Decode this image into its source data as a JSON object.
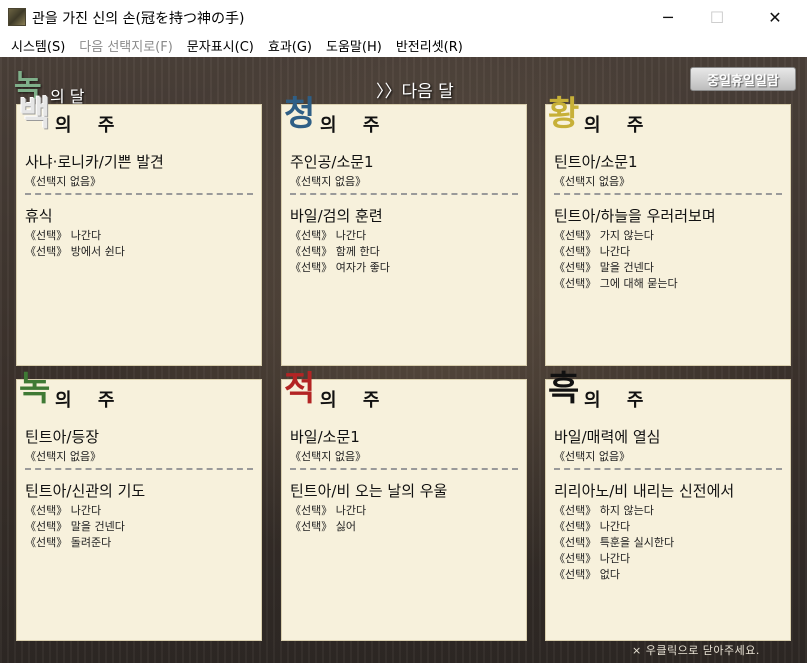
{
  "window": {
    "title": "관을 가진 신의 손(冠を持つ神の手)",
    "minimize": "─",
    "maximize": "☐",
    "close": "✕"
  },
  "menu": [
    {
      "label": "시스템(S)",
      "enabled": true
    },
    {
      "label": "다음 선택지로(F)",
      "enabled": false
    },
    {
      "label": "문자표시(C)",
      "enabled": true
    },
    {
      "label": "효과(G)",
      "enabled": true
    },
    {
      "label": "도움말(H)",
      "enabled": true
    },
    {
      "label": "반전리셋(R)",
      "enabled": true
    }
  ],
  "header": {
    "month_char": "녹",
    "month_rest": "의 달",
    "next_month": "〉〉다음 달",
    "schedule_button": "중일휴일일람"
  },
  "weeks": [
    {
      "char": "백",
      "char_color": "#e6e6e6",
      "label": "의 주",
      "events": [
        {
          "title": "사냐·로니카/기쁜 발견",
          "choices": [
            "《선택지 없음》"
          ]
        },
        {
          "title": "휴식",
          "choices": [
            "《선택》 나간다",
            "《선택》 방에서 쉰다"
          ]
        }
      ]
    },
    {
      "char": "청",
      "char_color": "#2f5f86",
      "label": "의 주",
      "events": [
        {
          "title": "주인공/소문1",
          "choices": [
            "《선택지 없음》"
          ]
        },
        {
          "title": "바일/검의 훈련",
          "choices": [
            "《선택》 나간다",
            "《선택》 함께 한다",
            "《선택》 여자가 좋다"
          ]
        }
      ]
    },
    {
      "char": "황",
      "char_color": "#c7b038",
      "label": "의 주",
      "events": [
        {
          "title": "틴트아/소문1",
          "choices": [
            "《선택지 없음》"
          ]
        },
        {
          "title": "틴트아/하늘을 우러러보며",
          "choices": [
            "《선택》 가지 않는다",
            "《선택》 나간다",
            "《선택》 말을 건넨다",
            "《선택》 그에 대해 묻는다"
          ]
        }
      ]
    },
    {
      "char": "녹",
      "char_color": "#3f7a35",
      "label": "의 주",
      "events": [
        {
          "title": "틴트아/등장",
          "choices": [
            "《선택지 없음》"
          ]
        },
        {
          "title": "틴트아/신관의 기도",
          "choices": [
            "《선택》 나간다",
            "《선택》 말을 건넨다",
            "《선택》 돌려준다"
          ]
        }
      ]
    },
    {
      "char": "적",
      "char_color": "#b32424",
      "label": "의 주",
      "events": [
        {
          "title": "바일/소문1",
          "choices": [
            "《선택지 없음》"
          ]
        },
        {
          "title": "틴트아/비 오는 날의 우울",
          "choices": [
            "《선택》 나간다",
            "《선택》 싫어"
          ]
        }
      ]
    },
    {
      "char": "흑",
      "char_color": "#111111",
      "label": "의 주",
      "events": [
        {
          "title": "바일/매력에 열심",
          "choices": [
            "《선택지 없음》"
          ]
        },
        {
          "title": "리리아노/비 내리는 신전에서",
          "choices": [
            "《선택》 하지 않는다",
            "《선택》 나간다",
            "《선택》 특훈을 실시한다",
            "《선택》 나간다",
            "《선택》 없다"
          ]
        }
      ]
    }
  ],
  "footer": {
    "hint": "× 우클릭으로 닫아주세요."
  }
}
